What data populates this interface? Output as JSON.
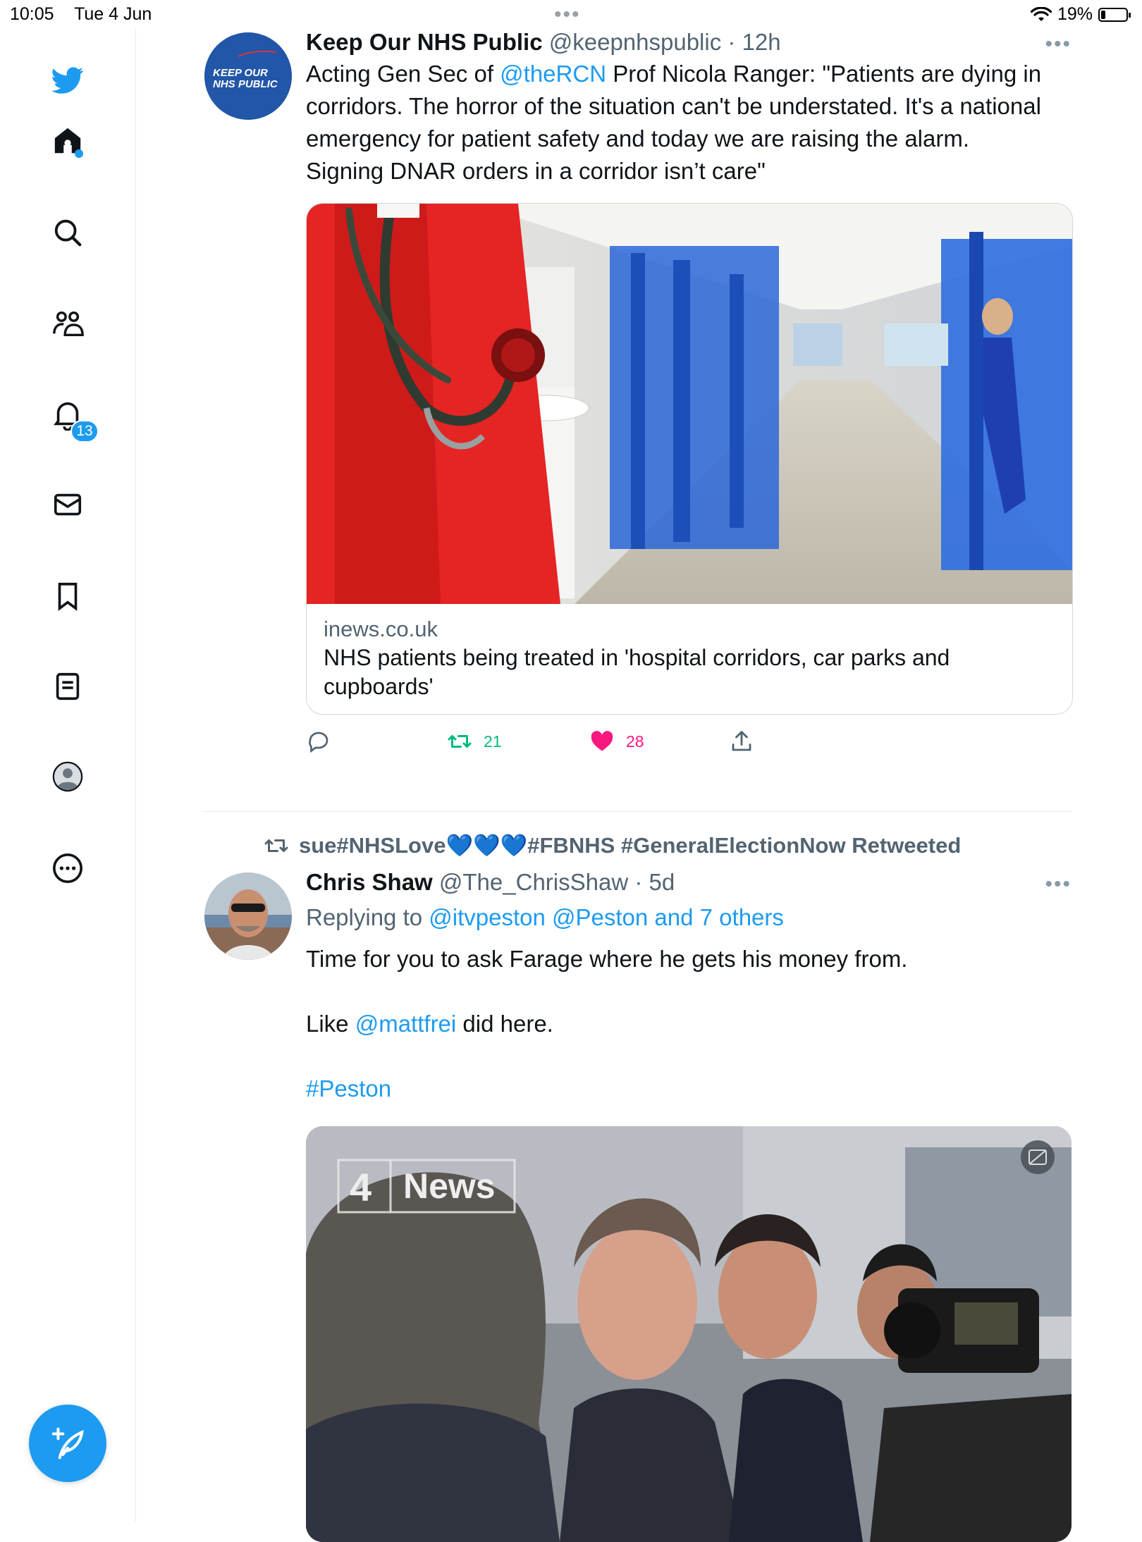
{
  "status_bar": {
    "time": "10:05",
    "date": "Tue 4 Jun",
    "battery": "19%",
    "battery_level": 0.19
  },
  "sidebar": {
    "items": [
      {
        "icon": "twitter-logo-icon",
        "label": "Twitter"
      },
      {
        "icon": "home-icon",
        "label": "Home"
      },
      {
        "icon": "search-icon",
        "label": "Explore"
      },
      {
        "icon": "communities-icon",
        "label": "Communities"
      },
      {
        "icon": "bell-icon",
        "label": "Notifications",
        "badge": "13"
      },
      {
        "icon": "mail-icon",
        "label": "Messages"
      },
      {
        "icon": "bookmark-icon",
        "label": "Bookmarks"
      },
      {
        "icon": "lists-icon",
        "label": "Lists"
      },
      {
        "icon": "profile-icon",
        "label": "Profile"
      },
      {
        "icon": "more-circle-icon",
        "label": "More"
      }
    ],
    "compose_icon": "compose-feather-icon",
    "accent_color": "#1d9bf0"
  },
  "tweets": [
    {
      "avatar_text_line1": "KEEP OUR",
      "avatar_text_line2": "NHS PUBLIC",
      "name": "Keep Our NHS Public",
      "handle": "@keepnhspublic",
      "sep": "·",
      "time": "12h",
      "text_prefix": "Acting Gen Sec of ",
      "mention": "@theRCN",
      "text_rest": " Prof Nicola Ranger: \"Patients are dying in corridors. The horror of the situation can't be understated. It's a national emergency for patient safety and today we are raising the alarm.",
      "text_line2": "Signing DNAR orders in a corridor isn’t care\"",
      "card": {
        "domain": "inews.co.uk",
        "title": "NHS patients being treated in 'hospital corridors, car parks and cupboards'"
      },
      "retweets": "21",
      "likes": "28"
    },
    {
      "retweeted_by": "sue#NHSLove💙💙💙#FBNHS #GeneralElectionNow Retweeted",
      "name": "Chris Shaw",
      "handle": "@The_ChrisShaw",
      "sep": "·",
      "time": "5d",
      "replying_label": "Replying to ",
      "replying_to": "@itvpeston @Peston and 7 others",
      "line1": "Time for you to ask Farage where he gets his money from.",
      "line2_prefix": "Like ",
      "line2_mention": "@mattfrei",
      "line2_rest": " did here.",
      "hashtag": "#Peston",
      "video_logo": "News",
      "video_logo_number": "4"
    }
  ]
}
